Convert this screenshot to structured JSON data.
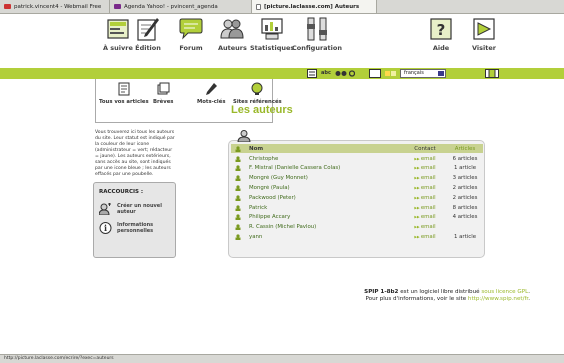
{
  "browser": {
    "tabs": [
      {
        "label": "patrick.vincent4 - Webmail Free"
      },
      {
        "label": "Agenda Yahoo! - pvincent_agenda"
      },
      {
        "label": "[picture.laclasse.com] Auteurs"
      }
    ],
    "status_url": "http://picture.laclasse.com/ecrire/?exec=auteurs"
  },
  "topnav": {
    "items": [
      {
        "label": "À suivre",
        "icon": "home-icon"
      },
      {
        "label": "Édition",
        "icon": "edit-icon"
      },
      {
        "label": "Forum",
        "icon": "forum-icon"
      },
      {
        "label": "Auteurs",
        "icon": "authors-icon"
      },
      {
        "label": "Statistiques",
        "icon": "statistics-icon"
      },
      {
        "label": "Configuration",
        "icon": "configuration-icon"
      },
      {
        "label": "Aide",
        "icon": "help-icon"
      },
      {
        "label": "Visiter",
        "icon": "visit-icon"
      }
    ]
  },
  "toolbar": {
    "language": "français",
    "abc_label": "abc"
  },
  "subnav": {
    "items": [
      {
        "label": "Tous vos articles",
        "icon": "articles-icon"
      },
      {
        "label": "Brèves",
        "icon": "breves-icon"
      },
      {
        "label": "Mots-clés",
        "icon": "keywords-icon"
      },
      {
        "label": "Sites référencés",
        "icon": "sites-icon"
      }
    ]
  },
  "info": {
    "text": "Vous trouverez ici tous les auteurs du site. Leur statut est indiqué par la couleur de leur icone (administrateur = vert; rédacteur = jaune). Les auteurs extérieurs, sans accès au site, sont indiqués par une icone bleue ; les auteurs effacés par une poubelle."
  },
  "shortcuts": {
    "title": "RACCOURCIS :",
    "items": [
      {
        "label": "Créer un nouvel auteur",
        "icon": "new-author-icon"
      },
      {
        "label": "Informations personnelles",
        "icon": "info-icon"
      }
    ]
  },
  "page": {
    "title": "Les auteurs"
  },
  "table": {
    "headers": {
      "name": "Nom",
      "contact": "Contact",
      "articles": "Articles"
    },
    "rows": [
      {
        "name": "Christophe",
        "contact": "email",
        "articles": "6 articles"
      },
      {
        "name": "F. Mistral (Danielle Cassera Colas)",
        "contact": "email",
        "articles": "1 article"
      },
      {
        "name": "Mongré (Guy Monnet)",
        "contact": "email",
        "articles": "3 articles"
      },
      {
        "name": "Mongré (Paula)",
        "contact": "email",
        "articles": "2 articles"
      },
      {
        "name": "Packwood (Peter)",
        "contact": "email",
        "articles": "2 articles"
      },
      {
        "name": "Patrick",
        "contact": "email",
        "articles": "8 articles"
      },
      {
        "name": "Philippe Accary",
        "contact": "email",
        "articles": "4 articles"
      },
      {
        "name": "R. Cassin (Michel Pavlou)",
        "contact": "email",
        "articles": ""
      },
      {
        "name": "yann",
        "contact": "email",
        "articles": "1 article"
      }
    ]
  },
  "footer": {
    "product": "SPIP 1-8b2",
    "line1_mid": " est un logiciel libre distribué ",
    "license": "sous licence GPL",
    "line1_end": ".",
    "line2_start": "Pour plus d'informations, voir le site ",
    "site": "http://www.spip.net/fr",
    "line2_end": "."
  },
  "colors": {
    "accent_green": "#b2cf3a",
    "title_green": "#9ab82a",
    "table_header": "#c8d290"
  }
}
